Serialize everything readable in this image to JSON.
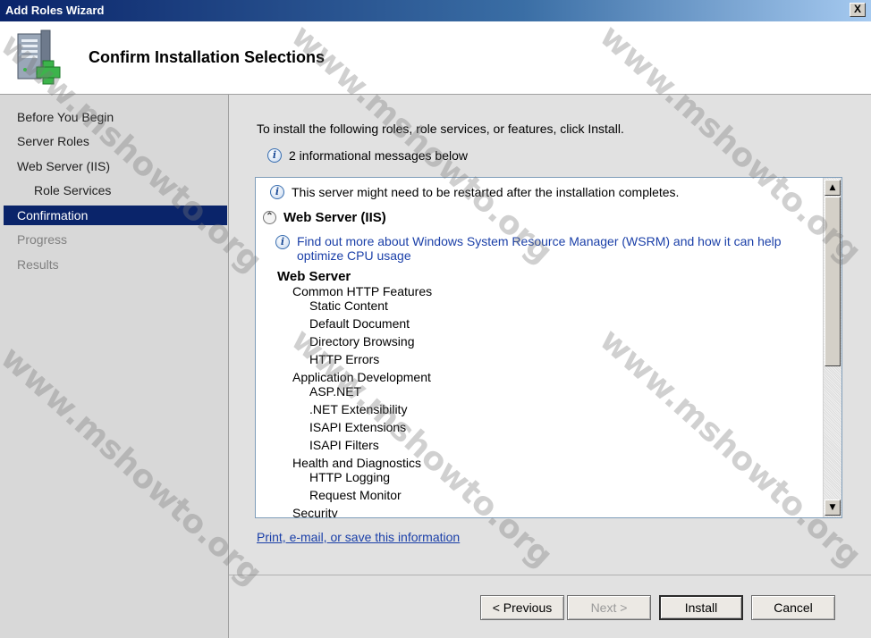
{
  "window": {
    "title": "Add Roles Wizard",
    "close_label": "X"
  },
  "header": {
    "title": "Confirm Installation Selections",
    "icon": "server-add-role-icon"
  },
  "sidebar": {
    "items": [
      {
        "label": "Before You Begin",
        "state": "normal"
      },
      {
        "label": "Server Roles",
        "state": "normal"
      },
      {
        "label": "Web Server (IIS)",
        "state": "normal"
      },
      {
        "label": "Role Services",
        "state": "normal",
        "indent": true
      },
      {
        "label": "Confirmation",
        "state": "active"
      },
      {
        "label": "Progress",
        "state": "disabled"
      },
      {
        "label": "Results",
        "state": "disabled"
      }
    ]
  },
  "main": {
    "intro": "To install the following roles, role services, or features, click Install.",
    "message_count": "2 informational messages below",
    "list": {
      "restart_message": "This server might need to be restarted after the installation completes.",
      "section_title": "Web Server (IIS)",
      "wsrm_link": "Find out more about Windows System Resource Manager (WSRM) and how it can help optimize CPU usage",
      "group_title": "Web Server",
      "entries": [
        {
          "text": "Common HTTP Features",
          "level": "cat"
        },
        {
          "text": "Static Content",
          "level": "feat"
        },
        {
          "text": "Default Document",
          "level": "feat"
        },
        {
          "text": "Directory Browsing",
          "level": "feat"
        },
        {
          "text": "HTTP Errors",
          "level": "feat"
        },
        {
          "text": "Application Development",
          "level": "cat"
        },
        {
          "text": "ASP.NET",
          "level": "feat"
        },
        {
          "text": ".NET Extensibility",
          "level": "feat"
        },
        {
          "text": "ISAPI Extensions",
          "level": "feat"
        },
        {
          "text": "ISAPI Filters",
          "level": "feat"
        },
        {
          "text": "Health and Diagnostics",
          "level": "cat"
        },
        {
          "text": "HTTP Logging",
          "level": "feat"
        },
        {
          "text": "Request Monitor",
          "level": "feat"
        },
        {
          "text": "Security",
          "level": "cat"
        }
      ]
    },
    "print_link": "Print, e-mail, or save this information"
  },
  "buttons": {
    "previous": "< Previous",
    "next": "Next >",
    "install": "Install",
    "cancel": "Cancel"
  },
  "watermark": {
    "text": "www.mshowto.org"
  },
  "colors": {
    "titlebar": "#0a246a",
    "active_item": "#0a246a",
    "link": "#1a3fa8"
  }
}
